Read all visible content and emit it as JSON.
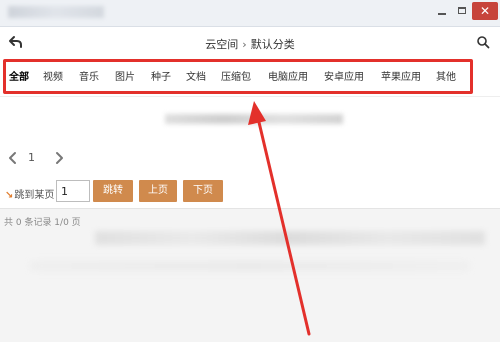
{
  "header": {
    "breadcrumb_parent": "云空间",
    "breadcrumb_separator": "›",
    "breadcrumb_current": "默认分类"
  },
  "tabs": [
    {
      "label": "全部",
      "active": true
    },
    {
      "label": "视频"
    },
    {
      "label": "音乐"
    },
    {
      "label": "图片"
    },
    {
      "label": "种子"
    },
    {
      "label": "文档"
    },
    {
      "label": "压缩包"
    },
    {
      "label": "电脑应用"
    },
    {
      "label": "安卓应用"
    },
    {
      "label": "苹果应用"
    },
    {
      "label": "其他"
    }
  ],
  "pagination": {
    "current_page": "1",
    "prev_icon": "chevron-left-icon",
    "next_icon": "chevron-right-icon"
  },
  "jump": {
    "label": "跳到某页",
    "input_value": "1",
    "go_label": "跳转",
    "prev_label": "上页",
    "next_label": "下页"
  },
  "status": {
    "text": "共 0 条记录 1/0 页"
  },
  "colors": {
    "accent_button": "#d08a4d",
    "highlight_red": "#e3302b",
    "close_button": "#c7443b"
  }
}
